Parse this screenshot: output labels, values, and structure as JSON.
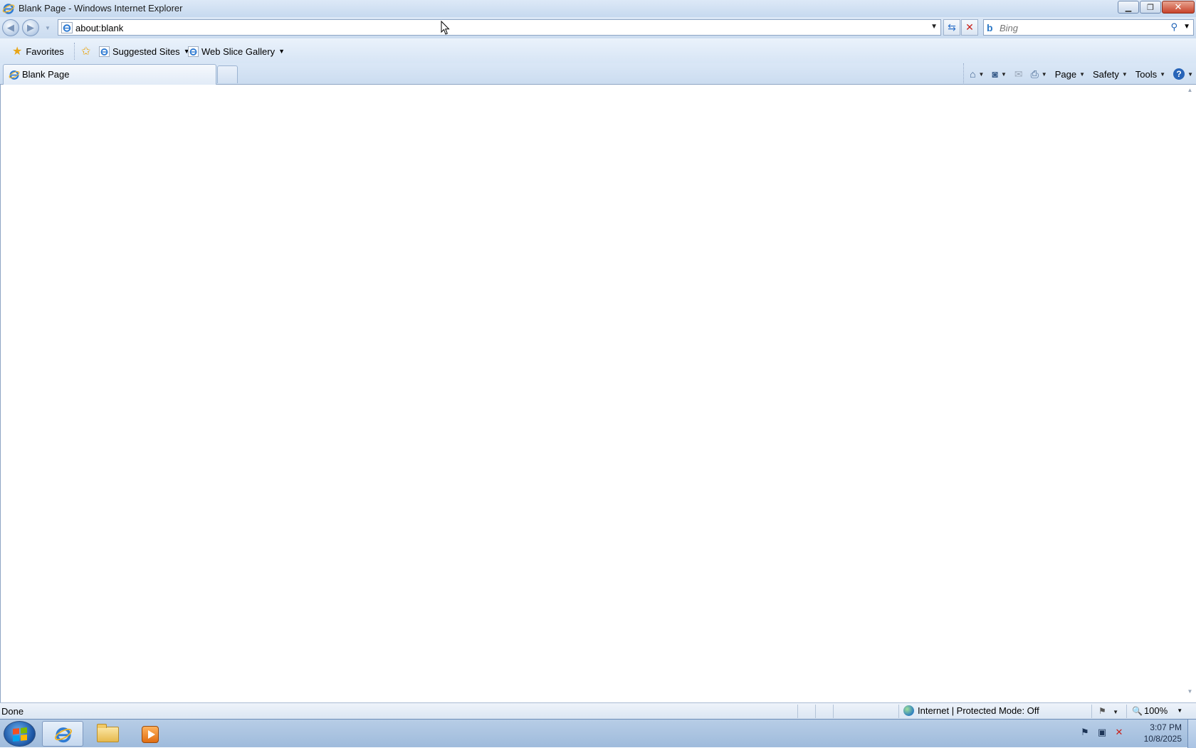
{
  "window": {
    "title": "Blank Page - Windows Internet Explorer",
    "minimize_glyph": "▁",
    "restore_glyph": "❐",
    "close_glyph": "✕"
  },
  "nav": {
    "back_glyph": "◀",
    "forward_glyph": "▶",
    "address_url": "about:blank",
    "dropdown_glyph": "▼",
    "refresh_glyph": "⇆",
    "stop_glyph": "✕"
  },
  "search": {
    "logo": "b",
    "placeholder": "Bing",
    "button_glyph": "⚲",
    "dropdown_glyph": "▼"
  },
  "favorites_bar": {
    "favorites_label": "Favorites",
    "suggested_sites_label": "Suggested Sites",
    "web_slice_gallery_label": "Web Slice Gallery",
    "caret": "▼"
  },
  "tabs": [
    {
      "label": "Blank Page"
    }
  ],
  "command_bar": {
    "home_glyph": "⌂",
    "feeds_glyph": "◙",
    "mail_glyph": "✉",
    "print_glyph": "⎙",
    "page_label": "Page",
    "safety_label": "Safety",
    "tools_label": "Tools",
    "help_glyph": "?",
    "caret": "▼"
  },
  "scrollbar": {
    "up_glyph": "▲",
    "down_glyph": "▼"
  },
  "status_bar": {
    "status_text": "Done",
    "zone_text": "Internet | Protected Mode: Off",
    "protect_glyph": "⚑",
    "zoom_glyph": "🔍",
    "zoom_level": "100%",
    "caret": "▼"
  },
  "taskbar": {
    "items": [
      "Internet Explorer",
      "Windows Explorer",
      "Windows Media Player"
    ],
    "tray_flag_glyph": "⚑",
    "tray_network_glyph": "▣",
    "tray_volume_glyph": "✕",
    "clock_time": "3:07 PM",
    "clock_date": "10/8/2025"
  },
  "colors": {
    "chrome_blue": "#cfe0f3",
    "close_red": "#c8432b",
    "ie_blue": "#2b78c6",
    "taskbar": "#9fbbdc"
  }
}
